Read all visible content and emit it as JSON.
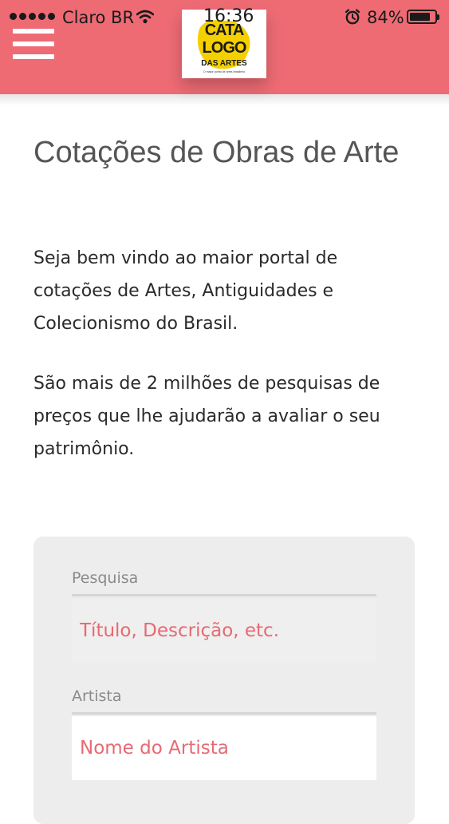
{
  "status_bar": {
    "carrier": "Claro BR",
    "time": "16:36",
    "battery": "84%",
    "battery_level": 0.84,
    "icons": [
      "signal-dots",
      "wifi-icon",
      "alarm-icon",
      "battery-icon"
    ]
  },
  "header": {
    "logo_text": [
      "CATA",
      "LOGO",
      "DAS ARTES"
    ],
    "logo_tagline": "O maior portal de artes brasileiro",
    "colors": {
      "header_bg": "#ee6b74",
      "logo_yellow": "#f5d000",
      "logo_text": "#1a1a1a"
    }
  },
  "main": {
    "title": "Cotações de Obras de Arte",
    "intro_1": "Seja bem vindo ao maior portal de cotações de Artes, Antiguidades e Colecionismo do Brasil.",
    "intro_2": "São mais de 2 milhões de pesquisas de preços que lhe ajudarão a avaliar o seu patrimônio."
  },
  "search": {
    "pesquisa_label": "Pesquisa",
    "pesquisa_placeholder": "Título, Descrição, etc.",
    "artista_label": "Artista",
    "artista_placeholder": "Nome do Artista"
  }
}
